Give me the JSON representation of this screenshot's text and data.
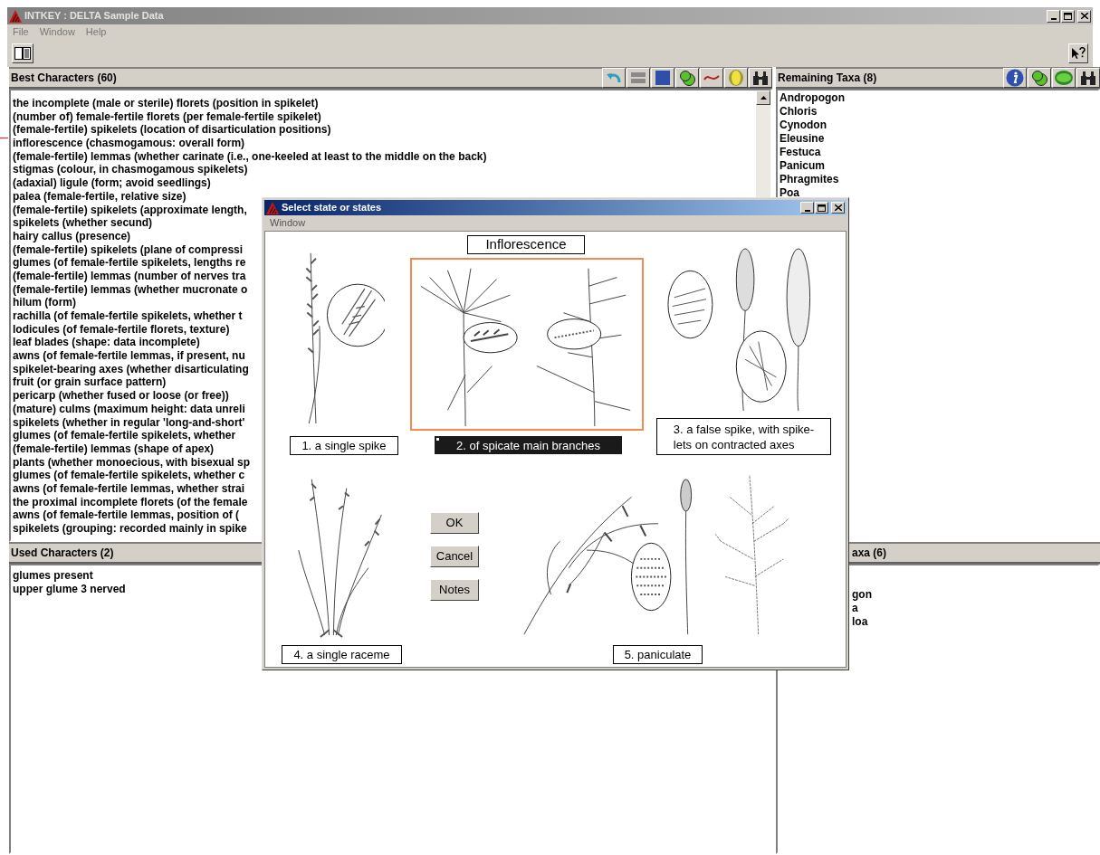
{
  "window": {
    "title": "INTKEY : DELTA Sample Data"
  },
  "menu": [
    "File",
    "Window",
    "Help"
  ],
  "best_characters": {
    "title": "Best Characters (60)",
    "items": [
      {
        "text": "the incomplete (male or sterile) florets (position in spikelet)",
        "marked": false
      },
      {
        "text": "(number of) female-fertile florets (per female-fertile spikelet)",
        "marked": false
      },
      {
        "text": "(female-fertile) spikelets (location of disarticulation positions)",
        "marked": false
      },
      {
        "text": "inflorescence (chasmogamous: overall form)",
        "marked": true
      },
      {
        "text": "(female-fertile) lemmas (whether carinate (i.e., one-keeled at least to the middle on the back)",
        "marked": false
      },
      {
        "text": "stigmas (colour, in chasmogamous spikelets)",
        "marked": false
      },
      {
        "text": "(adaxial) ligule (form; avoid seedlings)",
        "marked": false
      },
      {
        "text": "palea (female-fertile, relative size)",
        "marked": false
      },
      {
        "text": "(female-fertile) spikelets (approximate length,",
        "marked": false
      },
      {
        "text": "spikelets (whether secund)",
        "marked": false
      },
      {
        "text": "hairy callus (presence)",
        "marked": false
      },
      {
        "text": "(female-fertile) spikelets (plane of compressi",
        "marked": false
      },
      {
        "text": "glumes (of female-fertile spikelets, lengths re",
        "marked": false
      },
      {
        "text": "(female-fertile) lemmas (number of nerves tra",
        "marked": false
      },
      {
        "text": "(female-fertile) lemmas (whether mucronate o",
        "marked": false
      },
      {
        "text": "hilum (form)",
        "marked": false
      },
      {
        "text": "rachilla (of female-fertile spikelets, whether t",
        "marked": false
      },
      {
        "text": "lodicules (of female-fertile florets, texture)",
        "marked": false
      },
      {
        "text": "leaf blades (shape: data incomplete)",
        "marked": false
      },
      {
        "text": "awns (of female-fertile lemmas, if present, nu",
        "marked": false
      },
      {
        "text": "spikelet-bearing axes (whether disarticulating",
        "marked": false
      },
      {
        "text": "fruit (or grain surface pattern)",
        "marked": false
      },
      {
        "text": "pericarp (whether fused or loose (or free))",
        "marked": false
      },
      {
        "text": "(mature) culms (maximum height: data unreli",
        "marked": false
      },
      {
        "text": "spikelets (whether in regular 'long-and-short'",
        "marked": false
      },
      {
        "text": "glumes (of female-fertile spikelets, whether",
        "marked": false
      },
      {
        "text": "(female-fertile) lemmas (shape of apex)",
        "marked": false
      },
      {
        "text": "plants (whether monoecious, with bisexual sp",
        "marked": false
      },
      {
        "text": "glumes (of female-fertile spikelets, whether c",
        "marked": false
      },
      {
        "text": "awns (of female-fertile lemmas, whether strai",
        "marked": false
      },
      {
        "text": "the proximal incomplete florets (of the female",
        "marked": false
      },
      {
        "text": "awns (of female-fertile lemmas, position of (",
        "marked": false
      },
      {
        "text": "spikelets (grouping: recorded mainly in spike",
        "marked": false
      }
    ]
  },
  "used_characters": {
    "title": "Used Characters (2)",
    "items": [
      "glumes present",
      "upper glume 3 nerved"
    ]
  },
  "remaining_taxa": {
    "title": "Remaining Taxa (8)",
    "items": [
      "Andropogon",
      "Chloris",
      "Cynodon",
      "Eleusine",
      "Festuca",
      "Panicum",
      "Phragmites",
      "Poa"
    ]
  },
  "lower_right_panel": {
    "title": "axa (6)",
    "items": [
      "gon",
      "a",
      "loa"
    ]
  },
  "dialog": {
    "title": "Select state or states",
    "menu": [
      "Window"
    ],
    "heading": "Inflorescence",
    "options": [
      {
        "label": "1. a single spike",
        "selected": false
      },
      {
        "label": "2. of spicate main branches",
        "selected": true
      },
      {
        "label": "3. a false spike, with spike-\nlets on contracted axes",
        "selected": false
      },
      {
        "label": "4. a single raceme",
        "selected": false
      },
      {
        "label": "5. paniculate",
        "selected": false
      }
    ],
    "buttons": [
      "OK",
      "Cancel",
      "Notes"
    ]
  }
}
